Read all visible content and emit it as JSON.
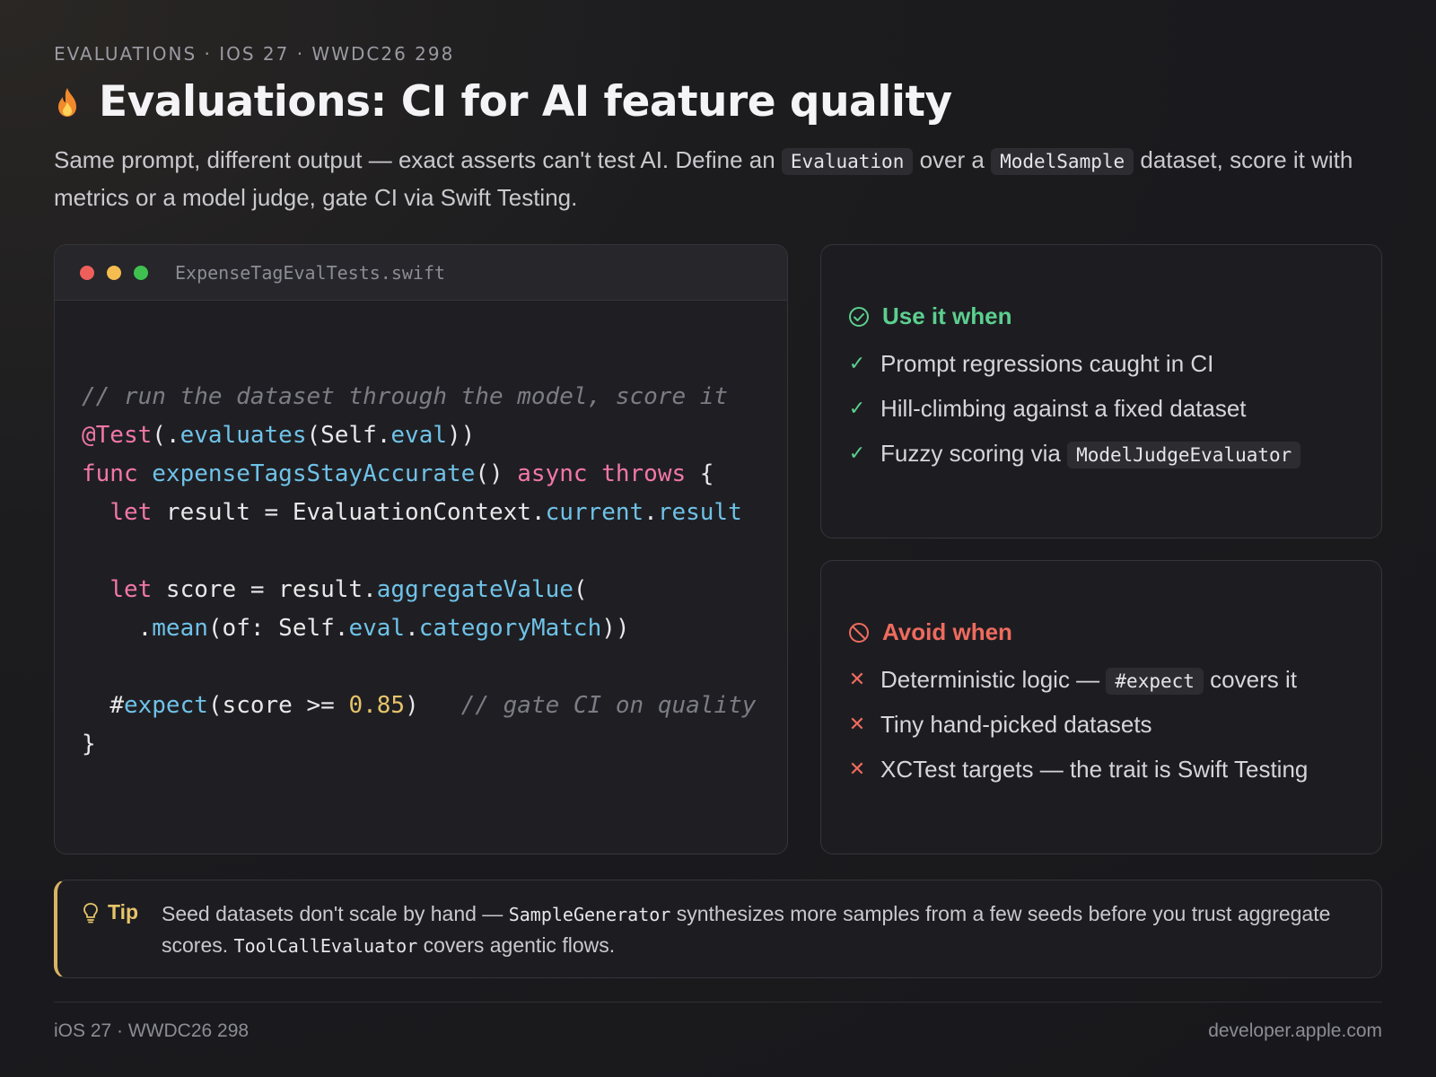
{
  "eyebrow": "EVALUATIONS · IOS 27 · WWDC26 298",
  "title": "Evaluations: CI for AI feature quality",
  "title_icon": "flame-icon",
  "subtitle": {
    "part1": "Same prompt, different output — exact asserts can't test AI. Define an ",
    "code1": "Evaluation",
    "part2": " over a ",
    "code2": "ModelSample",
    "part3": " dataset, score it with metrics or a model judge, gate CI via Swift Testing."
  },
  "code_card": {
    "filename": "ExpenseTagEvalTests.swift",
    "window_dots": [
      "#ee5f5b",
      "#f5bd4f",
      "#3fc150"
    ],
    "lines": {
      "l1_comment": "// run the dataset through the model, score it",
      "l2_attr": "@Test",
      "l2_p1": "(.",
      "l2_fn": "evaluates",
      "l2_p2": "(Self.",
      "l2_prop": "eval",
      "l2_p3": "))",
      "l3_kw1": "func",
      "l3_name": "expenseTagsStayAccurate",
      "l3_p1": "() ",
      "l3_kw2": "async",
      "l3_kw3": "throws",
      "l3_p2": " {",
      "l4_kw": "let",
      "l4_p1": " result = EvaluationContext.",
      "l4_prop1": "current",
      "l4_p2": ".",
      "l4_prop2": "result",
      "l5_kw": "let",
      "l5_p1": " score = result.",
      "l5_fn": "aggregateValue",
      "l5_p2": "(",
      "l6_p1": ".",
      "l6_fn": "mean",
      "l6_p2": "(of: Self.",
      "l6_prop1": "eval",
      "l6_p3": ".",
      "l6_prop2": "categoryMatch",
      "l6_p4": "))",
      "l7_p1": "#",
      "l7_fn": "expect",
      "l7_p2": "(score >= ",
      "l7_num": "0.85",
      "l7_p3": ")",
      "l7_comment": "// gate CI on quality",
      "l8": "}"
    }
  },
  "use_card": {
    "heading": "Use it when",
    "heading_color": "#5ccf8f",
    "icon": "check-circle-icon",
    "items": [
      {
        "text": "Prompt regressions caught in CI"
      },
      {
        "text": "Hill-climbing against a fixed dataset"
      },
      {
        "text": "Fuzzy scoring via ",
        "code": "ModelJudgeEvaluator"
      }
    ]
  },
  "avoid_card": {
    "heading": "Avoid when",
    "heading_color": "#ef6b5e",
    "icon": "prohibited-icon",
    "items": [
      {
        "text": "Deterministic logic — ",
        "code": "#expect",
        "after": " covers it"
      },
      {
        "text": "Tiny hand-picked datasets"
      },
      {
        "text": "XCTest targets — the trait is Swift Testing"
      }
    ]
  },
  "tip": {
    "label": "Tip",
    "icon": "lightbulb-icon",
    "part1": "Seed datasets don't scale by hand — ",
    "code1": "SampleGenerator",
    "part2": " synthesizes more samples from a few seeds before you trust aggregate scores. ",
    "code2": "ToolCallEvaluator",
    "part3": " covers agentic flows."
  },
  "footer": {
    "left": "iOS 27 · WWDC26 298",
    "right": "developer.apple.com"
  }
}
